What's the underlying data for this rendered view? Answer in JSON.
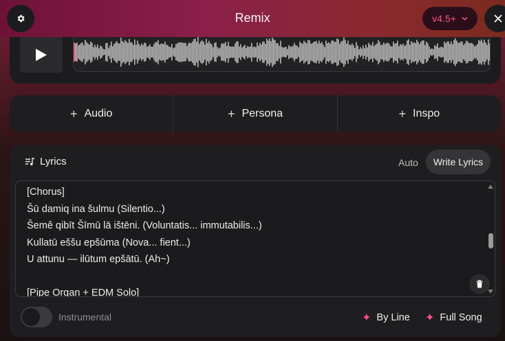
{
  "header": {
    "title": "Remix",
    "version": "v4.5+"
  },
  "add_buttons": [
    {
      "label": "Audio"
    },
    {
      "label": "Persona"
    },
    {
      "label": "Inspo"
    }
  ],
  "lyrics": {
    "title": "Lyrics",
    "modes": {
      "auto": "Auto",
      "write": "Write Lyrics",
      "selected": "Write Lyrics"
    },
    "lines": [
      "[Chorus]",
      "Šū damiq ina šulmu (Silentio...)",
      "Šemê qibīt Šīmū lā ištēni. (Voluntatis... immutabilis...)",
      "Kullatū eššu epšūma (Nova... fient...)",
      "U attunu — ilūtum epšātū. (Ah~)",
      "",
      "[Pipe Organ + EDM Solo]"
    ]
  },
  "footer": {
    "instrumental_label": "Instrumental",
    "instrumental_on": false,
    "by_line": "By Line",
    "full_song": "Full Song"
  },
  "colors": {
    "accent": "#ff4f8b"
  }
}
